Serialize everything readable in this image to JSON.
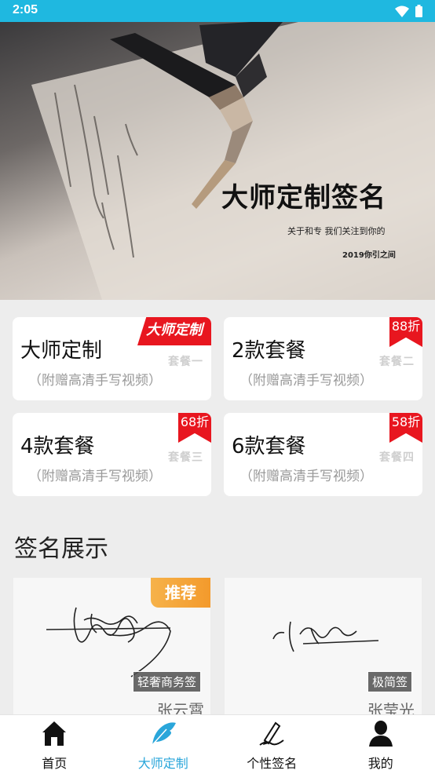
{
  "status_bar": {
    "time": "2:05"
  },
  "banner": {
    "title": "大师定制签名",
    "subtitle": "关于和专 我们关注到你的",
    "year_line": "2019你引之间"
  },
  "packages": [
    {
      "title": "大师定制",
      "subtitle": "（附赠高清手写视频）",
      "tag": "套餐一",
      "ribbon": "大师定制"
    },
    {
      "title": "2款套餐",
      "subtitle": "（附赠高清手写视频）",
      "tag": "套餐二",
      "ribbon": "88折"
    },
    {
      "title": "4款套餐",
      "subtitle": "（附赠高清手写视频）",
      "tag": "套餐三",
      "ribbon": "68折"
    },
    {
      "title": "6款套餐",
      "subtitle": "（附赠高清手写视频）",
      "tag": "套餐四",
      "ribbon": "58折"
    }
  ],
  "showcase": {
    "title": "签名展示",
    "cards": [
      {
        "name": "张云霄",
        "badge": "轻奢商务签",
        "ribbon": "推荐"
      },
      {
        "name": "张莹光",
        "badge": "极简签"
      }
    ]
  },
  "tab_bar": {
    "items": [
      {
        "label": "首页",
        "icon": "home-icon"
      },
      {
        "label": "大师定制",
        "icon": "feather-icon",
        "active": true
      },
      {
        "label": "个性签名",
        "icon": "pen-icon"
      },
      {
        "label": "我的",
        "icon": "user-icon"
      }
    ]
  },
  "colors": {
    "status_bar": "#1fb8e0",
    "accent": "#2aa6da",
    "ribbon_red": "#e8161f",
    "recommend_orange": "#f6b24a"
  }
}
